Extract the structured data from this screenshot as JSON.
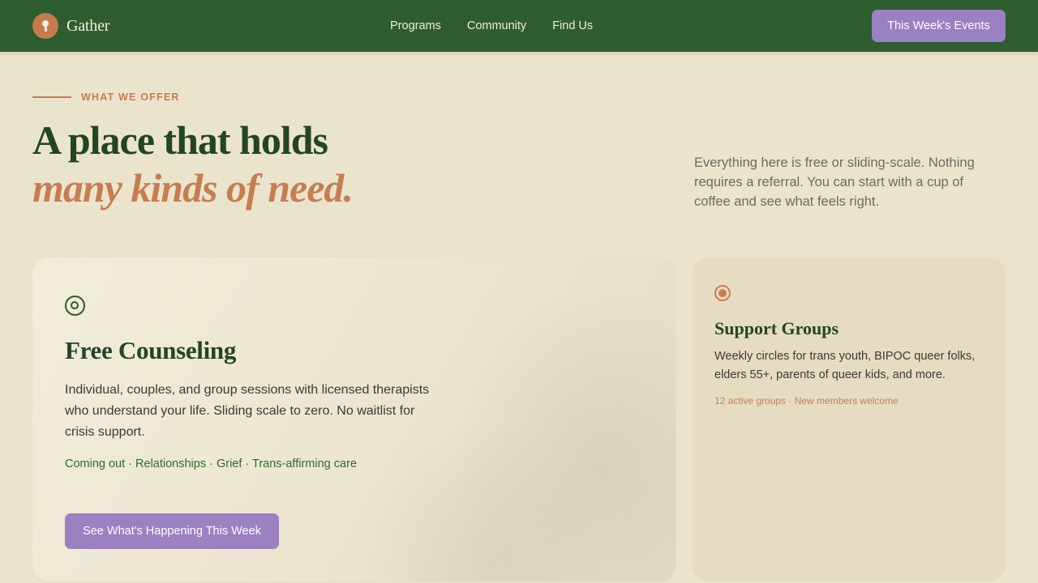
{
  "nav": {
    "brand": "Gather",
    "links": [
      "Programs",
      "Community",
      "Find Us"
    ],
    "cta": "This Week's Events"
  },
  "hero": {
    "eyebrow": "WHAT WE OFFER",
    "headline_line1": "A place that holds",
    "headline_line2": "many kinds of need.",
    "intro": "Everything here is free or sliding-scale. Nothing requires a referral. You can start with a cup of coffee and see what feels right."
  },
  "counseling": {
    "icon": "target-icon",
    "title": "Free Counseling",
    "description": "Individual, couples, and group sessions with licensed therapists who understand your life. Sliding scale to zero. No waitlist for crisis support.",
    "tags": "Coming out · Relationships · Grief · Trans-affirming care",
    "cta": "See What's Happening This Week"
  },
  "support_groups": {
    "icon": "radio-dot-icon",
    "title": "Support Groups",
    "description": "Weekly circles for trans youth, BIPOC queer folks, elders 55+, parents of queer kids, and more.",
    "meta": "12 active groups · New members welcome"
  },
  "colors": {
    "nav_green": "#2e5d2f",
    "accent_purple": "#9b80c2",
    "accent_terracotta": "#c77d51",
    "background_cream": "#ebe4cc"
  }
}
